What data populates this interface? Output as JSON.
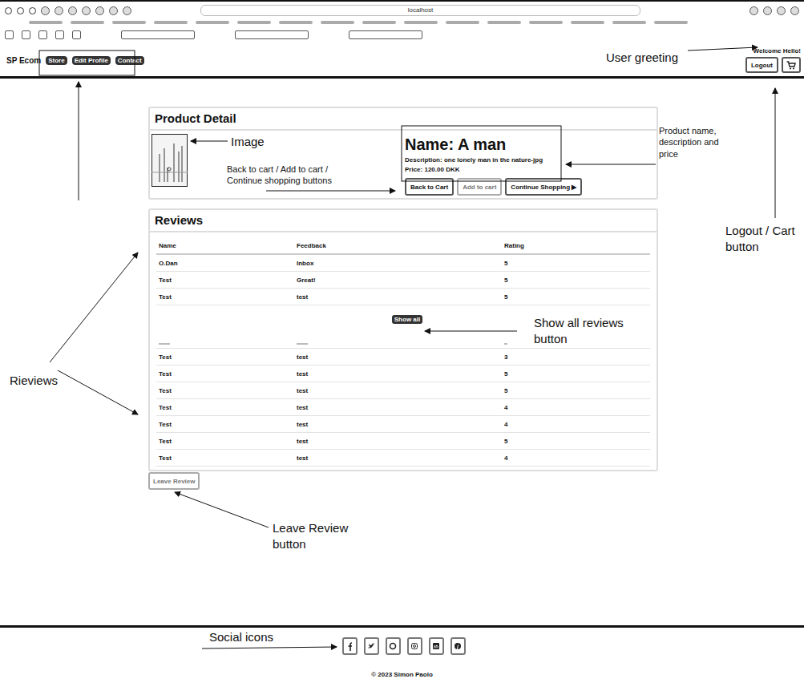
{
  "browser": {
    "address": "localhost"
  },
  "navbar": {
    "brand": "SP Ecom",
    "links": [
      "Store",
      "Edit Profile",
      "Contact"
    ],
    "greeting": "Welcome Hello!",
    "logout": "Logout"
  },
  "product": {
    "title": "Product Detail",
    "name": "Name: A man",
    "description": "Description: one lonely man in the nature-jpg",
    "price": "Price: 120.00 DKK",
    "buttons": [
      {
        "label": "Back to Cart",
        "disabled": false
      },
      {
        "label": "Add to cart",
        "disabled": true
      },
      {
        "label": "Continue Shopping ▶",
        "disabled": false
      }
    ]
  },
  "reviews": {
    "title": "Reviews",
    "columns": [
      "Name",
      "Feedback",
      "Rating"
    ],
    "rows": [
      {
        "name": "O.Dan",
        "feedback": "Inbox",
        "rating": "5"
      },
      {
        "name": "Test",
        "feedback": "Great!",
        "rating": "5"
      },
      {
        "name": "Test",
        "feedback": "test",
        "rating": "5"
      }
    ],
    "show_all": "Show all",
    "more_rows": [
      {
        "name": "Test",
        "feedback": "test",
        "rating": "3"
      },
      {
        "name": "Test",
        "feedback": "test",
        "rating": "5"
      },
      {
        "name": "Test",
        "feedback": "test",
        "rating": "5"
      },
      {
        "name": "Test",
        "feedback": "test",
        "rating": "4"
      },
      {
        "name": "Test",
        "feedback": "test",
        "rating": "4"
      },
      {
        "name": "Test",
        "feedback": "test",
        "rating": "5"
      },
      {
        "name": "Test",
        "feedback": "test",
        "rating": "4"
      }
    ]
  },
  "leave_review": {
    "label": "Leave Review",
    "disabled": true
  },
  "footer": {
    "copyright": "© 2023 Simon Paolo"
  },
  "annotations": {
    "user_greeting": "User greeting",
    "image": "Image",
    "buttons": "Back to cart / Add to cart / Continue shopping buttons",
    "product_info": "Product name, description and price",
    "logout_cart": "Logout / Cart button",
    "show_all": "Show all reviews button",
    "reviews": "Rieviews",
    "leave_review": "Leave Review button",
    "social": "Social icons"
  }
}
